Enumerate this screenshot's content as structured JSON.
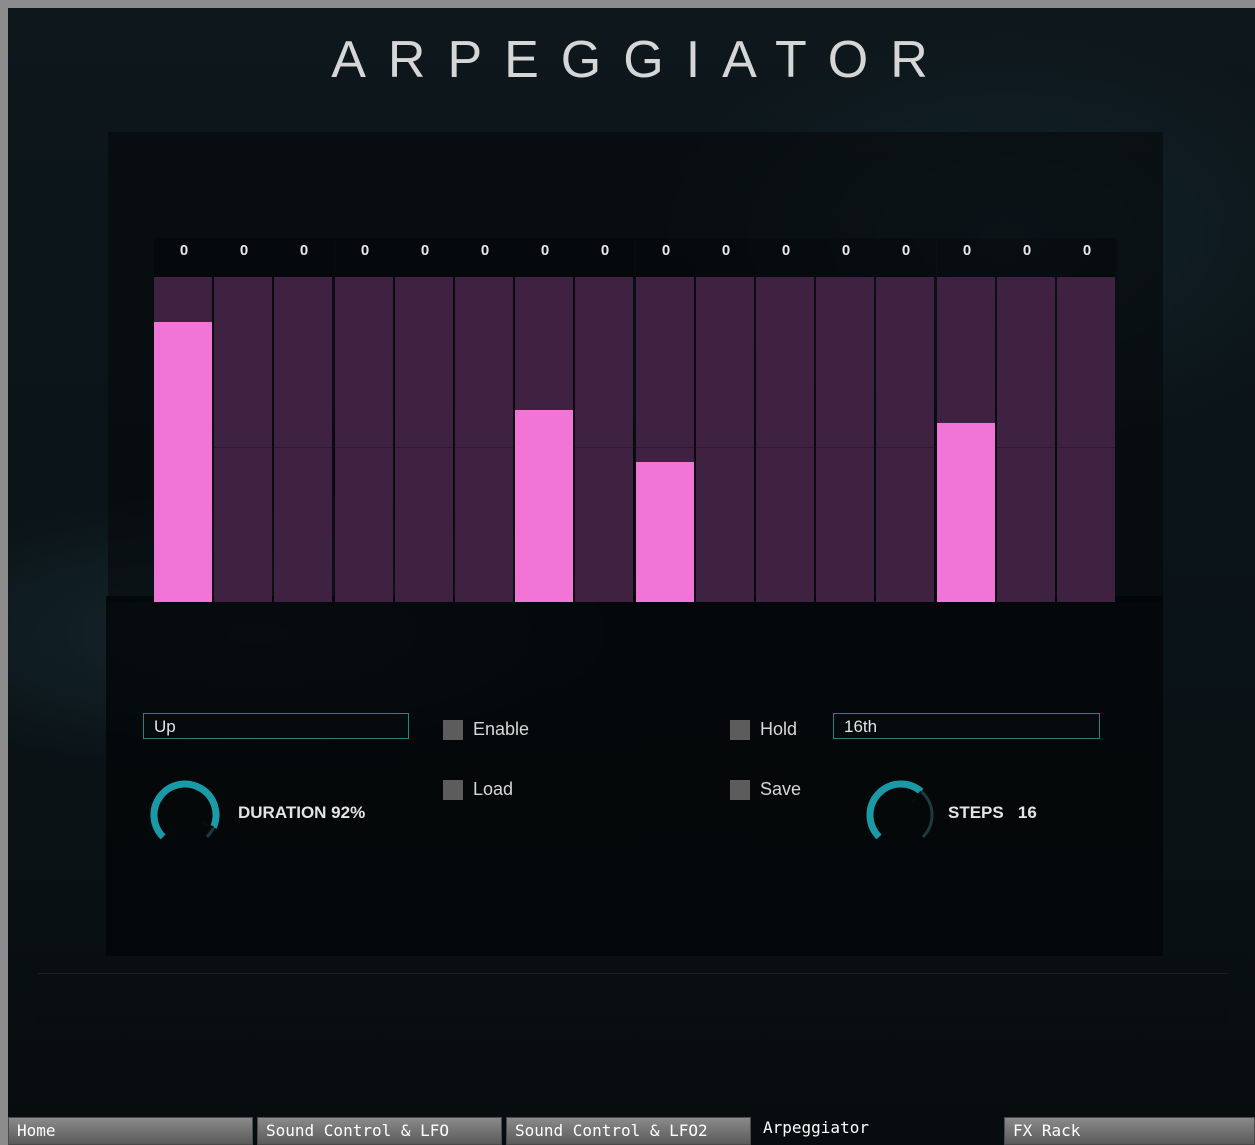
{
  "title": "ARPEGGIATOR",
  "steps": [
    {
      "value": "0",
      "level": 0.86
    },
    {
      "value": "0",
      "level": 0
    },
    {
      "value": "0",
      "level": 0
    },
    {
      "value": "0",
      "level": 0
    },
    {
      "value": "0",
      "level": 0
    },
    {
      "value": "0",
      "level": 0
    },
    {
      "value": "0",
      "level": 0.59
    },
    {
      "value": "0",
      "level": 0
    },
    {
      "value": "0",
      "level": 0.43
    },
    {
      "value": "0",
      "level": 0
    },
    {
      "value": "0",
      "level": 0
    },
    {
      "value": "0",
      "level": 0
    },
    {
      "value": "0",
      "level": 0
    },
    {
      "value": "0",
      "level": 0.55
    },
    {
      "value": "0",
      "level": 0
    },
    {
      "value": "0",
      "level": 0
    }
  ],
  "controls": {
    "mode_value": "Up",
    "rate_value": "16th",
    "enable_label": "Enable",
    "load_label": "Load",
    "hold_label": "Hold",
    "save_label": "Save",
    "duration_label": "DURATION 92%",
    "duration_level": 0.92,
    "steps_label": "STEPS",
    "steps_value": "16",
    "steps_level": 0.65
  },
  "tabs": [
    {
      "label": "Home",
      "active": false
    },
    {
      "label": "Sound Control & LFO",
      "active": false
    },
    {
      "label": "Sound Control & LFO2",
      "active": false
    },
    {
      "label": "Arpeggiator",
      "active": true
    },
    {
      "label": "FX Rack",
      "active": false
    }
  ],
  "colors": {
    "bar_fill": "#f075d6",
    "step_bg": "#3f2142",
    "knob_accent": "#1a9aa6",
    "field_border": "#2d7f86"
  }
}
